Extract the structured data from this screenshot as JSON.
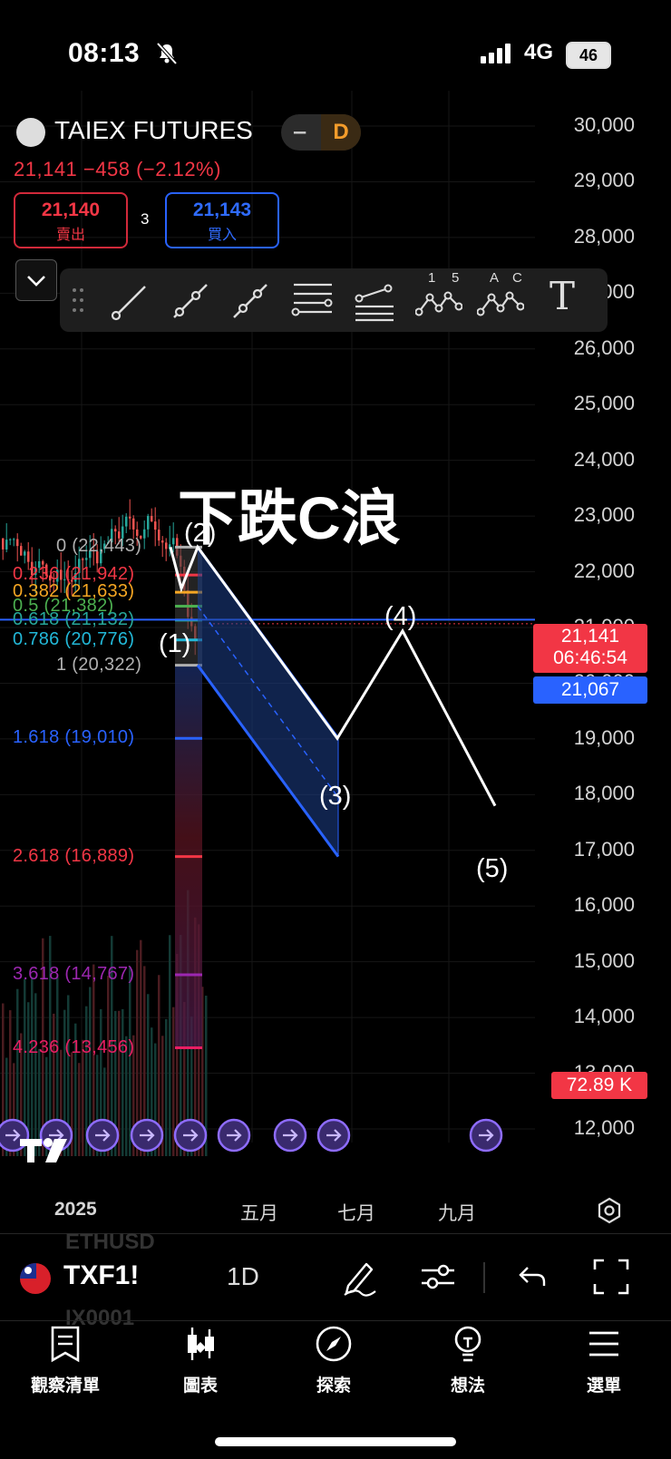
{
  "status_bar": {
    "time": "08:13",
    "network": "4G",
    "battery": "46"
  },
  "header": {
    "symbol_name": "TAIEX FUTURES",
    "interval_badge": "D",
    "price_change": "21,141 −458 (−2.12%)",
    "sell_price": "21,140",
    "sell_label": "賣出",
    "spread": "3",
    "buy_price": "21,143",
    "buy_label": "買入"
  },
  "toolbar": {
    "tools": [
      "trend-line-icon",
      "ray-icon",
      "extended-line-icon",
      "parallel-lines-icon",
      "fib-retracement-icon",
      "elliott-wave-icon",
      "abc-correction-icon",
      "text-icon"
    ],
    "wave_numbers": [
      "1",
      "5"
    ],
    "abc_letters": [
      "A",
      "C"
    ],
    "text_tool": "T"
  },
  "chart_data": {
    "type": "candlestick",
    "annotation_title": "下跌C浪",
    "y_axis": [
      "30,000",
      "29,000",
      "28,000",
      "27,000",
      "26,000",
      "25,000",
      "24,000",
      "23,000",
      "22,000",
      "21,000",
      "20,000",
      "19,000",
      "18,000",
      "17,000",
      "16,000",
      "15,000",
      "14,000",
      "13,000",
      "12,000"
    ],
    "ylim": [
      12000,
      30000
    ],
    "x_axis": [
      "2025",
      "五月",
      "七月",
      "九月"
    ],
    "fib_levels": [
      {
        "label": "0 (22,443)",
        "value": 22443,
        "color": "#b0b0b0"
      },
      {
        "label": "0.236 (21,942)",
        "value": 21942,
        "color": "#f23645"
      },
      {
        "label": "0.382 (21,633)",
        "value": 21633,
        "color": "#f5a623"
      },
      {
        "label": "0.5 (21,382)",
        "value": 21382,
        "color": "#4caf50"
      },
      {
        "label": "0.618 (21,132)",
        "value": 21132,
        "color": "#26a69a"
      },
      {
        "label": "0.786 (20,776)",
        "value": 20776,
        "color": "#22b8d8"
      },
      {
        "label": "1 (20,322)",
        "value": 20322,
        "color": "#b0b0b0"
      },
      {
        "label": "1.618 (19,010)",
        "value": 19010,
        "color": "#2962ff"
      },
      {
        "label": "2.618 (16,889)",
        "value": 16889,
        "color": "#f23645"
      },
      {
        "label": "3.618 (14,767)",
        "value": 14767,
        "color": "#9c27b0"
      },
      {
        "label": "4.236 (13,456)",
        "value": 13456,
        "color": "#e91e63"
      }
    ],
    "wave_labels": [
      "(1)",
      "(2)",
      "(3)",
      "(4)",
      "(5)"
    ],
    "last_price": "21,141",
    "countdown": "06:46:54",
    "secondary_price": "21,067",
    "volume_label": "72.89 K"
  },
  "bottom_bar": {
    "ticker": "TXF1!",
    "timeframe": "1D",
    "ghost_top": "ETHUSD",
    "ghost_bottom": "IX0001"
  },
  "nav": [
    {
      "label": "觀察清單",
      "icon": "watchlist-icon"
    },
    {
      "label": "圖表",
      "icon": "chart-icon"
    },
    {
      "label": "探索",
      "icon": "compass-icon"
    },
    {
      "label": "想法",
      "icon": "lightbulb-icon"
    },
    {
      "label": "選單",
      "icon": "menu-icon"
    }
  ]
}
